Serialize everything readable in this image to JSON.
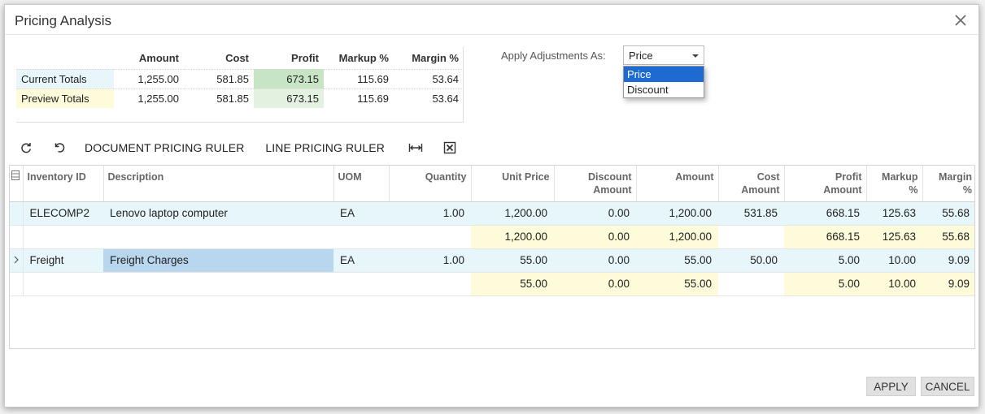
{
  "dialog": {
    "title": "Pricing Analysis"
  },
  "totals": {
    "headers": [
      "",
      "Amount",
      "Cost",
      "Profit",
      "Markup %",
      "Margin %"
    ],
    "rows": [
      {
        "label": "Current Totals",
        "amount": "1,255.00",
        "cost": "581.85",
        "profit": "673.15",
        "markup": "115.69",
        "margin": "53.64"
      },
      {
        "label": "Preview Totals",
        "amount": "1,255.00",
        "cost": "581.85",
        "profit": "673.15",
        "markup": "115.69",
        "margin": "53.64"
      }
    ]
  },
  "adjust": {
    "label": "Apply Adjustments As:",
    "selected": "Price",
    "options": [
      "Price",
      "Discount"
    ]
  },
  "toolbar": {
    "document_ruler": "DOCUMENT PRICING RULER",
    "line_ruler": "LINE PRICING RULER"
  },
  "grid": {
    "headers": {
      "inventory_id": "Inventory ID",
      "description": "Description",
      "uom": "UOM",
      "quantity": "Quantity",
      "unit_price": "Unit Price",
      "discount_amount_1": "Discount",
      "discount_amount_2": "Amount",
      "amount": "Amount",
      "cost_amount_1": "Cost",
      "cost_amount_2": "Amount",
      "profit_amount_1": "Profit",
      "profit_amount_2": "Amount",
      "markup_1": "Markup",
      "markup_2": "%",
      "margin_1": "Margin",
      "margin_2": "%"
    },
    "rows": [
      {
        "inventory_id": "ELECOMP2",
        "description": "Lenovo laptop computer",
        "uom": "EA",
        "quantity": "1.00",
        "unit_price": "1,200.00",
        "discount": "0.00",
        "amount": "1,200.00",
        "cost": "531.85",
        "profit": "668.15",
        "markup": "125.63",
        "margin": "55.68",
        "preview": {
          "unit_price": "1,200.00",
          "discount": "0.00",
          "amount": "1,200.00",
          "profit": "668.15",
          "markup": "125.63",
          "margin": "55.68"
        }
      },
      {
        "inventory_id": "Freight",
        "description": "Freight Charges",
        "uom": "EA",
        "quantity": "1.00",
        "unit_price": "55.00",
        "discount": "0.00",
        "amount": "55.00",
        "cost": "50.00",
        "profit": "5.00",
        "markup": "10.00",
        "margin": "9.09",
        "preview": {
          "unit_price": "55.00",
          "discount": "0.00",
          "amount": "55.00",
          "profit": "5.00",
          "markup": "10.00",
          "margin": "9.09"
        }
      }
    ]
  },
  "footer": {
    "apply": "APPLY",
    "cancel": "CANCEL"
  },
  "colors": {
    "selected_option": "#1d6bd1",
    "current_row": "#e7f6fb",
    "preview_row": "#fdfbd9",
    "profit_current": "#c7e4c4"
  }
}
